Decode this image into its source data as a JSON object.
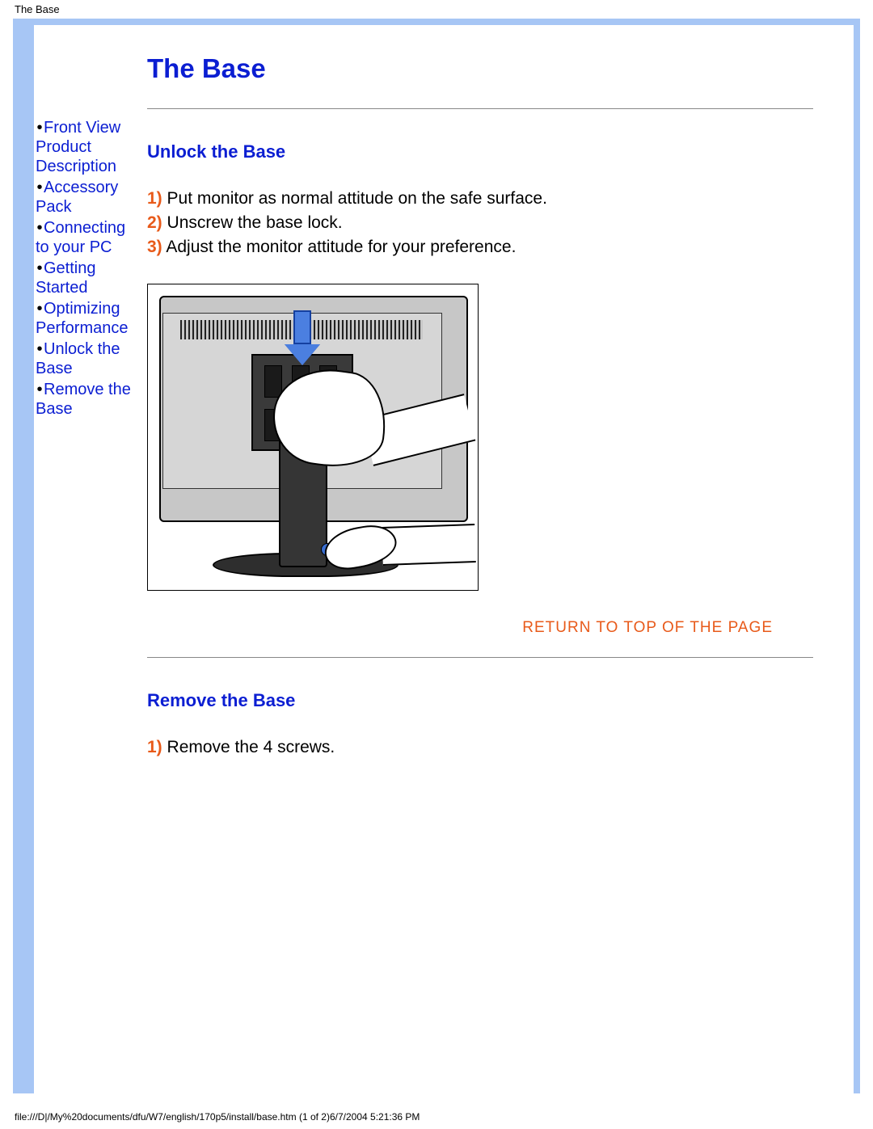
{
  "top_label": "The Base",
  "page_title": "The Base",
  "sidebar": {
    "items": [
      {
        "label": "Front View Product Description"
      },
      {
        "label": "Accessory Pack"
      },
      {
        "label": "Connecting to your PC"
      },
      {
        "label": "Getting Started"
      },
      {
        "label": "Optimizing Performance"
      },
      {
        "label": "Unlock the Base"
      },
      {
        "label": "Remove the Base"
      }
    ]
  },
  "section1": {
    "title": "Unlock the Base",
    "steps": [
      {
        "num": "1)",
        "text": " Put monitor as normal attitude on the safe surface."
      },
      {
        "num": "2)",
        "text": " Unscrew the base lock."
      },
      {
        "num": "3)",
        "text": " Adjust the monitor attitude for your preference."
      }
    ]
  },
  "return_link": "RETURN TO TOP OF THE PAGE",
  "section2": {
    "title": "Remove the Base",
    "steps": [
      {
        "num": "1)",
        "text": " Remove the 4 screws."
      }
    ]
  },
  "footer": "file:///D|/My%20documents/dfu/W7/english/170p5/install/base.htm (1 of 2)6/7/2004 5:21:36 PM"
}
